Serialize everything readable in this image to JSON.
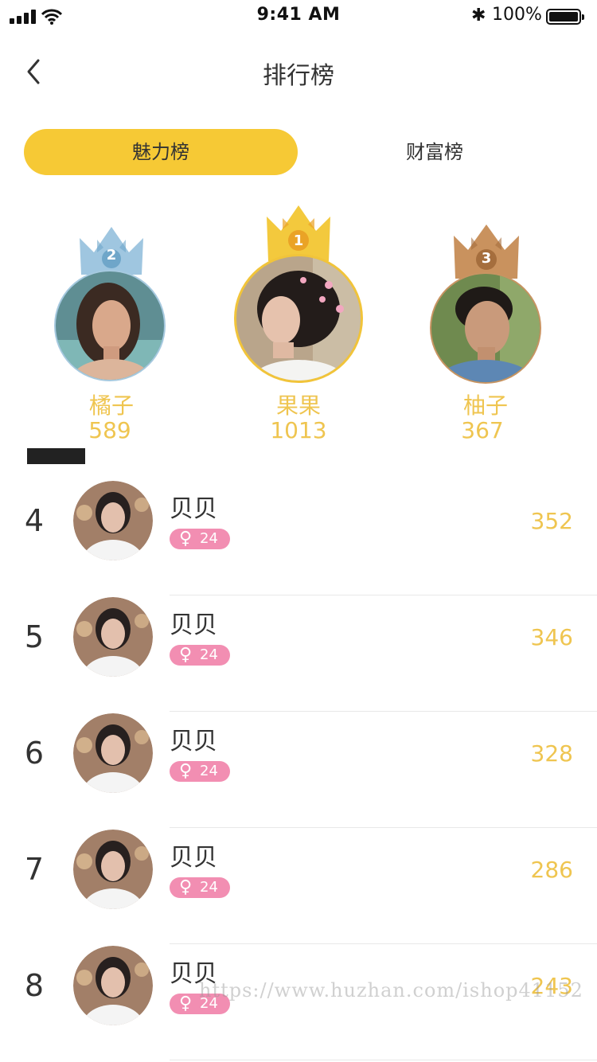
{
  "status": {
    "time": "9:41 AM",
    "battery": "100%"
  },
  "header": {
    "title": "排行榜"
  },
  "tabs": [
    {
      "label": "魅力榜",
      "active": true
    },
    {
      "label": "财富榜",
      "active": false
    }
  ],
  "podium": [
    {
      "rank": "2",
      "name": "橘子",
      "score": "589",
      "crown_color": "#9fc6e0",
      "ring_color": "#a6c9df"
    },
    {
      "rank": "1",
      "name": "果果",
      "score": "1013",
      "crown_color": "#f3c93d",
      "ring_color": "#f1c43a"
    },
    {
      "rank": "3",
      "name": "柚子",
      "score": "367",
      "crown_color": "#c9925e",
      "ring_color": "#c89462"
    }
  ],
  "list": [
    {
      "rank": "4",
      "name": "贝贝",
      "gender": "♀",
      "age": "24",
      "score": "352"
    },
    {
      "rank": "5",
      "name": "贝贝",
      "gender": "♀",
      "age": "24",
      "score": "346"
    },
    {
      "rank": "6",
      "name": "贝贝",
      "gender": "♀",
      "age": "24",
      "score": "328"
    },
    {
      "rank": "7",
      "name": "贝贝",
      "gender": "♀",
      "age": "24",
      "score": "286"
    },
    {
      "rank": "8",
      "name": "贝贝",
      "gender": "♀",
      "age": "24",
      "score": "243"
    }
  ],
  "watermark": "https://www.huzhan.com/ishop41152",
  "colors": {
    "accent": "#f6c935",
    "score": "#efc550",
    "badge": "#f28eb2"
  }
}
